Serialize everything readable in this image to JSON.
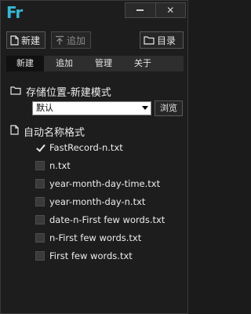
{
  "app": {
    "logo_text": "Fr",
    "accent_color": "#36b7d4",
    "window_buttons": {
      "minimize_icon": "minimize-icon",
      "close_icon": "close-icon",
      "close_glyph": "✕"
    }
  },
  "toolbar": {
    "new_label": "新建",
    "add_label": "追加",
    "dir_label": "目录",
    "add_disabled": true
  },
  "tabs": [
    {
      "label": "新建",
      "active": true
    },
    {
      "label": "追加",
      "active": false
    },
    {
      "label": "管理",
      "active": false
    },
    {
      "label": "关于",
      "active": false
    }
  ],
  "storage": {
    "heading": "存储位置-新建模式",
    "selected": "默认",
    "browse_label": "浏览"
  },
  "autoname": {
    "heading": "自动名称格式",
    "options": [
      {
        "label": "FastRecord-n.txt",
        "checked": true
      },
      {
        "label": "n.txt",
        "checked": false
      },
      {
        "label": "year-month-day-time.txt",
        "checked": false
      },
      {
        "label": "year-month-day-n.txt",
        "checked": false
      },
      {
        "label": "date-n-First few words.txt",
        "checked": false
      },
      {
        "label": "n-First few words.txt",
        "checked": false
      },
      {
        "label": "First few words.txt",
        "checked": false
      }
    ]
  }
}
